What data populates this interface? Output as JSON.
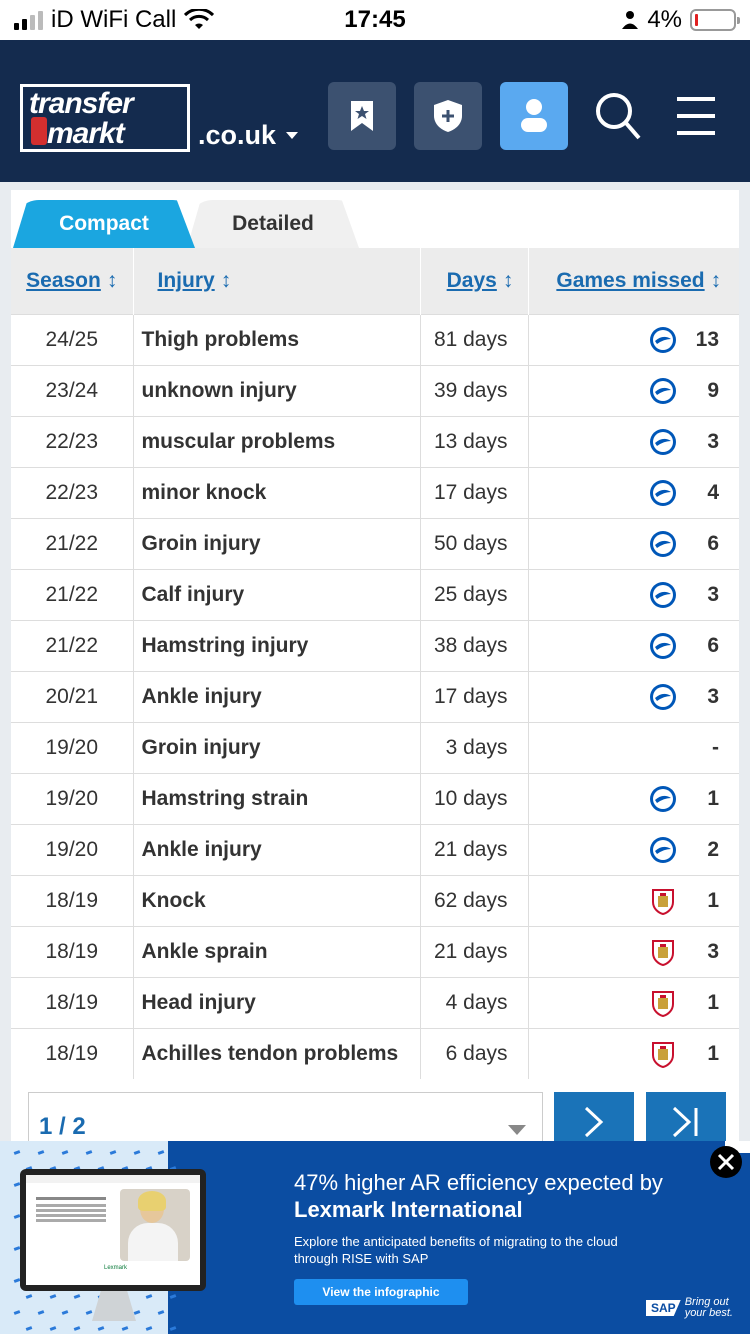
{
  "status_bar": {
    "carrier": "iD WiFi Call",
    "time": "17:45",
    "battery": "4%",
    "signal_bars": 2
  },
  "header": {
    "logo_line1": "transfer",
    "logo_line2": "markt",
    "domain": ".co.uk",
    "icons": [
      "bookmark-icon",
      "shield-plus-icon",
      "user-icon",
      "search-icon",
      "menu-icon"
    ]
  },
  "tabs": {
    "compact": "Compact",
    "detailed": "Detailed",
    "active": "Compact"
  },
  "table": {
    "headers": {
      "season": "Season",
      "injury": "Injury",
      "days": "Days",
      "games": "Games missed"
    },
    "rows": [
      {
        "season": "24/25",
        "injury": "Thigh problems",
        "days": "81 days",
        "games": "13",
        "club": "brighton"
      },
      {
        "season": "23/24",
        "injury": "unknown injury",
        "days": "39 days",
        "games": "9",
        "club": "brighton"
      },
      {
        "season": "22/23",
        "injury": "muscular problems",
        "days": "13 days",
        "games": "3",
        "club": "brighton"
      },
      {
        "season": "22/23",
        "injury": "minor knock",
        "days": "17 days",
        "games": "4",
        "club": "brighton"
      },
      {
        "season": "21/22",
        "injury": "Groin injury",
        "days": "50 days",
        "games": "6",
        "club": "brighton"
      },
      {
        "season": "21/22",
        "injury": "Calf injury",
        "days": "25 days",
        "games": "3",
        "club": "brighton"
      },
      {
        "season": "21/22",
        "injury": "Hamstring injury",
        "days": "38 days",
        "games": "6",
        "club": "brighton"
      },
      {
        "season": "20/21",
        "injury": "Ankle injury",
        "days": "17 days",
        "games": "3",
        "club": "brighton"
      },
      {
        "season": "19/20",
        "injury": "Groin injury",
        "days": "3 days",
        "games": "-",
        "club": ""
      },
      {
        "season": "19/20",
        "injury": "Hamstring strain",
        "days": "10 days",
        "games": "1",
        "club": "brighton"
      },
      {
        "season": "19/20",
        "injury": "Ankle injury",
        "days": "21 days",
        "games": "2",
        "club": "brighton"
      },
      {
        "season": "18/19",
        "injury": "Knock",
        "days": "62 days",
        "games": "1",
        "club": "bristol"
      },
      {
        "season": "18/19",
        "injury": "Ankle sprain",
        "days": "21 days",
        "games": "3",
        "club": "bristol"
      },
      {
        "season": "18/19",
        "injury": "Head injury",
        "days": "4 days",
        "games": "1",
        "club": "bristol"
      },
      {
        "season": "18/19",
        "injury": "Achilles tendon problems",
        "days": "6 days",
        "games": "1",
        "club": "bristol"
      }
    ]
  },
  "pager": {
    "value": "1 / 2",
    "next_icon": "chevron-right-icon",
    "last_icon": "last-page-icon"
  },
  "ad": {
    "headline_1": "47% higher AR efficiency expected by",
    "headline_2": "Lexmark International",
    "subtext": "Explore the anticipated benefits of migrating to the cloud through RISE with SAP",
    "cta": "View the infographic",
    "brand": "SAP",
    "tagline": "Bring out your best.",
    "screen_logo": "Lexmark"
  },
  "colors": {
    "header_bg": "#142b4e",
    "accent_blue": "#1ba6e0",
    "link_blue": "#1a6bb0",
    "active_button": "#5aa9f0",
    "ad_bg": "#0b4da2"
  }
}
